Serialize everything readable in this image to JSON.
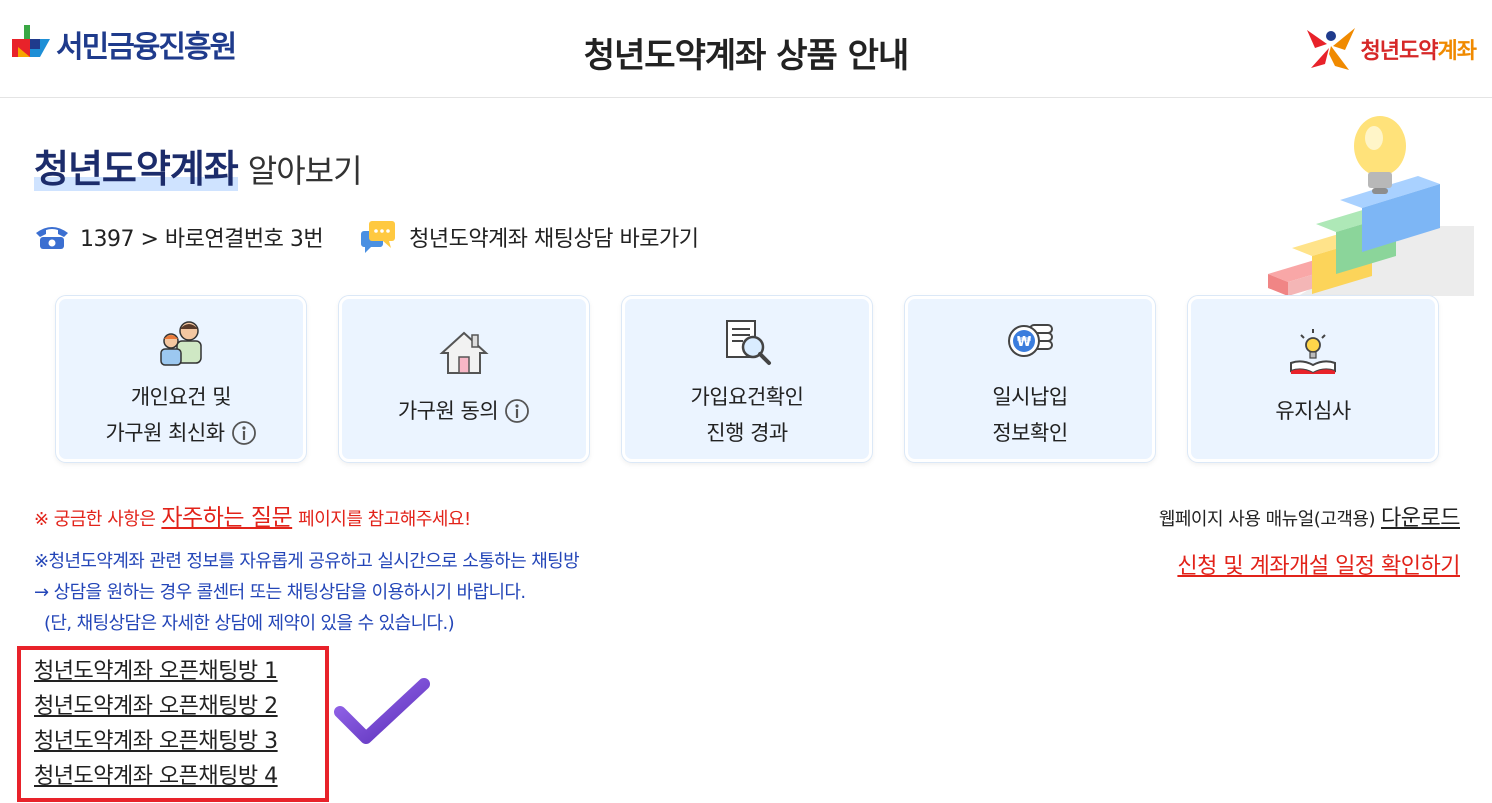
{
  "header": {
    "logo_left_text": "서민금융진흥원",
    "title": "청년도약계좌 상품 안내",
    "logo_right_text_part1": "청년도약",
    "logo_right_text_part2": "계좌"
  },
  "section": {
    "title_strong": "청년도약계좌",
    "title_light": "알아보기"
  },
  "contact": {
    "phone_icon": "phone-icon",
    "phone_text": "1397 > 바로연결번호 3번",
    "chat_icon": "chat-bubble-icon",
    "chat_text": "청년도약계좌 채팅상담 바로가기"
  },
  "cards": [
    {
      "icon": "people-icon",
      "line1": "개인요건 및",
      "line2": "가구원 최신화",
      "info": true
    },
    {
      "icon": "house-icon",
      "line1": "가구원 동의",
      "line2": "",
      "info": true
    },
    {
      "icon": "document-search-icon",
      "line1": "가입요건확인",
      "line2": "진행 경과",
      "info": false
    },
    {
      "icon": "coins-icon",
      "line1": "일시납입",
      "line2": "정보확인",
      "info": false
    },
    {
      "icon": "book-lightbulb-icon",
      "line1": "유지심사",
      "line2": "",
      "info": false
    }
  ],
  "notices": {
    "red_prefix": "※ 궁금한 사항은",
    "red_link": "자주하는 질문",
    "red_suffix": "페이지를 참고해주세요!",
    "manual_text": "웹페이지 사용 매뉴얼(고객용)",
    "manual_link": "다운로드",
    "schedule_link": "신청 및 계좌개설 일정 확인하기",
    "blue_line1": "※청년도약계좌 관련 정보를 자유롭게 공유하고 실시간으로 소통하는 채팅방",
    "blue_line2": "→ 상담을 원하는 경우 콜센터 또는 채팅상담을 이용하시기 바랍니다.",
    "blue_line3": "(단, 채팅상담은 자세한 상담에 제약이 있을 수 있습니다.)"
  },
  "chat_rooms": [
    "청년도약계좌 오픈채팅방 1",
    "청년도약계좌 오픈채팅방 2",
    "청년도약계좌 오픈채팅방 3",
    "청년도약계좌 오픈채팅방 4"
  ],
  "colors": {
    "accent_red": "#e2231a",
    "notice_blue": "#2446b8",
    "card_bg": "#ebf4ff",
    "title_navy": "#1c2c6b",
    "check_purple": "#6a3fc8"
  }
}
